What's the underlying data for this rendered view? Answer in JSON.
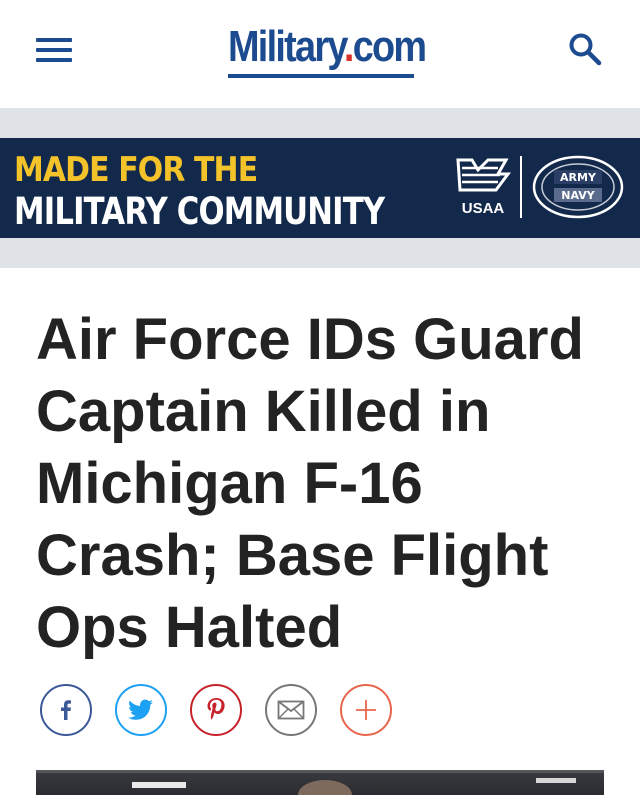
{
  "header": {
    "menu_icon": "hamburger-menu-icon",
    "logo": {
      "text_main": "Military",
      "text_dot": ".",
      "text_tld": "com",
      "color": "#1c4b8f",
      "dot_color": "#d8312b"
    },
    "search_icon": "search-icon"
  },
  "ad_banner": {
    "line1": "MADE FOR THE",
    "line2": "MILITARY COMMUNITY",
    "sponsor": "USAA",
    "badge_top": "ARMY",
    "badge_bottom": "NAVY",
    "background": "#13294b",
    "accent": "#f4c32a"
  },
  "article": {
    "headline": "Air Force IDs Guard Captain Killed in Michigan F-16 Crash; Base Flight Ops Halted",
    "share_buttons": [
      {
        "network": "facebook",
        "icon": "facebook-icon",
        "color": "#3b5998"
      },
      {
        "network": "twitter",
        "icon": "twitter-icon",
        "color": "#1da1f2"
      },
      {
        "network": "pinterest",
        "icon": "pinterest-icon",
        "color": "#c8232c"
      },
      {
        "network": "email",
        "icon": "envelope-icon",
        "color": "#777777"
      },
      {
        "network": "more",
        "icon": "plus-icon",
        "color": "#e8654d"
      }
    ]
  }
}
